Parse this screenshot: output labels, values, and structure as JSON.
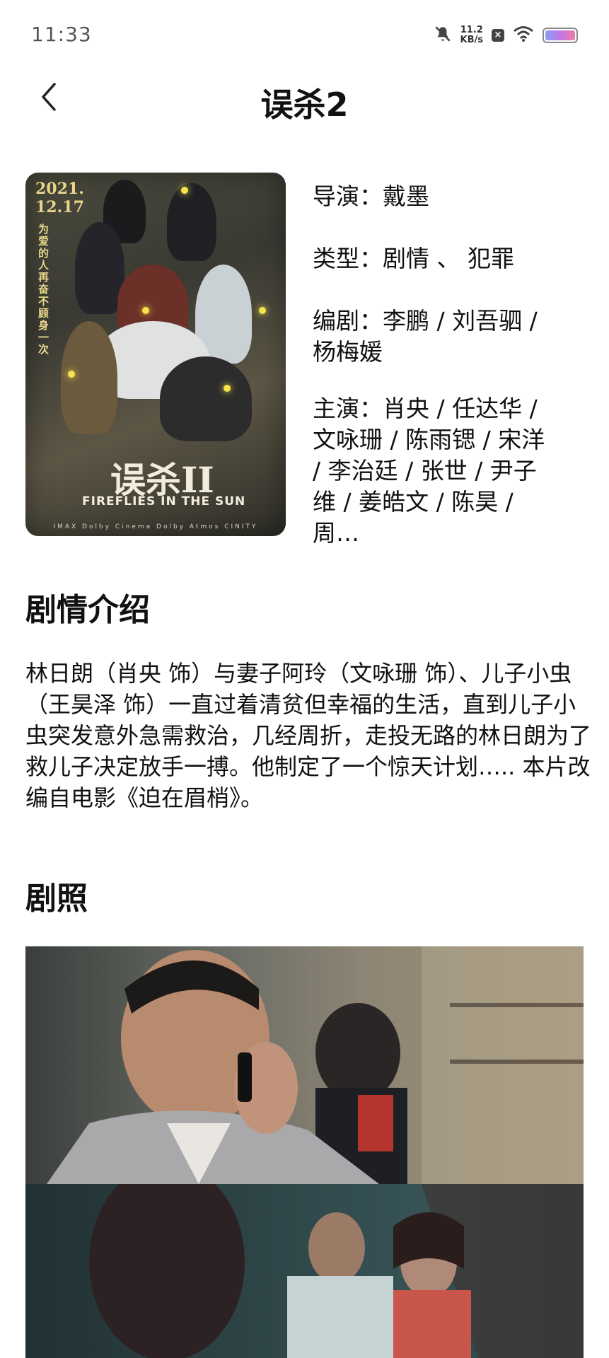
{
  "status_bar": {
    "time": "11:33",
    "net_speed_value": "11.2",
    "net_speed_unit": "KB/s",
    "icons": [
      "mute-icon",
      "close-notification-icon",
      "wifi-icon",
      "battery-icon"
    ]
  },
  "header": {
    "title": "误杀2",
    "back_icon": "chevron-left-icon"
  },
  "movie": {
    "poster": {
      "date": "2021.\n12.17",
      "tagline": "为爱的人 再奋不顾身一次",
      "logo_text": "误杀II",
      "english_title": "FIREFLIES IN THE SUN",
      "credits": "IMAX  Dolby Cinema  Dolby Atmos  CINITY"
    },
    "director": "导演：戴墨",
    "genre": "类型：剧情 、 犯罪",
    "writers": "编剧：李鹏 / 刘吾驷 / 杨梅媛",
    "cast": "主演：肖央 / 任达华 / 文咏珊 / 陈雨锶 / 宋洋 / 李治廷 / 张世 / 尹子维 / 姜皓文 / 陈昊 / 周…"
  },
  "plot": {
    "heading": "剧情介绍",
    "text": "林日朗（肖央 饰）与妻子阿玲（文咏珊 饰）、儿子小虫（王昊泽 饰）一直过着清贫但幸福的生活，直到儿子小虫突发意外急需救治，几经周折，走投无路的林日朗为了救儿子决定放手一搏。他制定了一个惊天计划….. 本片改编自电影《迫在眉梢》。"
  },
  "stills": {
    "heading": "剧照"
  },
  "colors": {
    "text": "#111111",
    "status_text": "#555555",
    "background": "#ffffff",
    "poster_accent": "#e8d58a"
  }
}
